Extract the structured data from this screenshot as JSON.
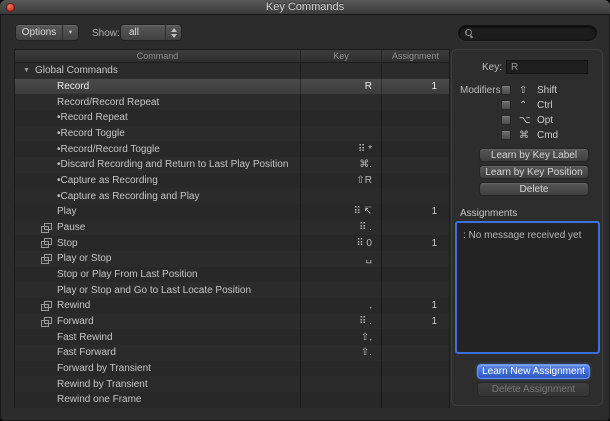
{
  "window": {
    "title": "Key Commands"
  },
  "toolbar": {
    "options_label": "Options",
    "show_label": "Show:",
    "show_value": "all",
    "search_value": ""
  },
  "table": {
    "columns": [
      "Command",
      "Key",
      "Assignment"
    ],
    "rows": [
      {
        "label": "Global Commands",
        "type": "group",
        "key": "",
        "assignment": ""
      },
      {
        "label": "Record",
        "key": "R",
        "assignment": "1",
        "selected": true
      },
      {
        "label": "Record/Record Repeat",
        "key": "",
        "assignment": ""
      },
      {
        "label": "•Record Repeat",
        "key": "",
        "assignment": ""
      },
      {
        "label": "•Record Toggle",
        "key": "",
        "assignment": ""
      },
      {
        "label": "•Record/Record Toggle",
        "key": "⠿ *",
        "assignment": ""
      },
      {
        "label": "•Discard Recording and Return to Last Play Position",
        "key": "⌘.",
        "assignment": ""
      },
      {
        "label": "•Capture as Recording",
        "key": "⇧R",
        "assignment": ""
      },
      {
        "label": "•Capture as Recording and Play",
        "key": "",
        "assignment": ""
      },
      {
        "label": "Play",
        "key": "⠿ ↸",
        "assignment": "1"
      },
      {
        "label": "Pause",
        "icon": true,
        "key": "⠿ .",
        "assignment": ""
      },
      {
        "label": "Stop",
        "icon": true,
        "key": "⠿ 0",
        "assignment": "1"
      },
      {
        "label": "Play or Stop",
        "icon": true,
        "key": "␣",
        "assignment": ""
      },
      {
        "label": "Stop or Play From Last Position",
        "key": "",
        "assignment": ""
      },
      {
        "label": "Play or Stop and Go to Last Locate Position",
        "key": "",
        "assignment": ""
      },
      {
        "label": "Rewind",
        "icon": true,
        "key": ",",
        "assignment": "1"
      },
      {
        "label": "Forward",
        "icon": true,
        "key": "⠿ .",
        "assignment": "1"
      },
      {
        "label": "Fast Rewind",
        "key": "⇧,",
        "assignment": ""
      },
      {
        "label": "Fast Forward",
        "key": "⇧.",
        "assignment": ""
      },
      {
        "label": "Forward by Transient",
        "key": "",
        "assignment": ""
      },
      {
        "label": "Rewind by Transient",
        "key": "",
        "assignment": ""
      },
      {
        "label": "Rewind one Frame",
        "key": "",
        "assignment": ""
      }
    ]
  },
  "inspector": {
    "key_label": "Key:",
    "key_value": "R",
    "modifiers_label": "Modifiers:",
    "modifiers": [
      {
        "symbol": "⇧",
        "label": "Shift",
        "checked": false
      },
      {
        "symbol": "⌃",
        "label": "Ctrl",
        "checked": false
      },
      {
        "symbol": "⌥",
        "label": "Opt",
        "checked": false
      },
      {
        "symbol": "⌘",
        "label": "Cmd",
        "checked": false
      }
    ],
    "buttons": {
      "learn_by_key_label": "Learn by Key Label",
      "learn_by_key_position": "Learn by Key Position",
      "delete": "Delete"
    },
    "assignments_label": "Assignments",
    "assignments_message": ": No message received yet",
    "learn_new_assignment": "Learn New Assignment",
    "delete_assignment": "Delete Assignment"
  },
  "colors": {
    "accent_blue": "#3a6fdc",
    "selection_gray": "#434343",
    "window_bg": "#2c2c2c"
  }
}
